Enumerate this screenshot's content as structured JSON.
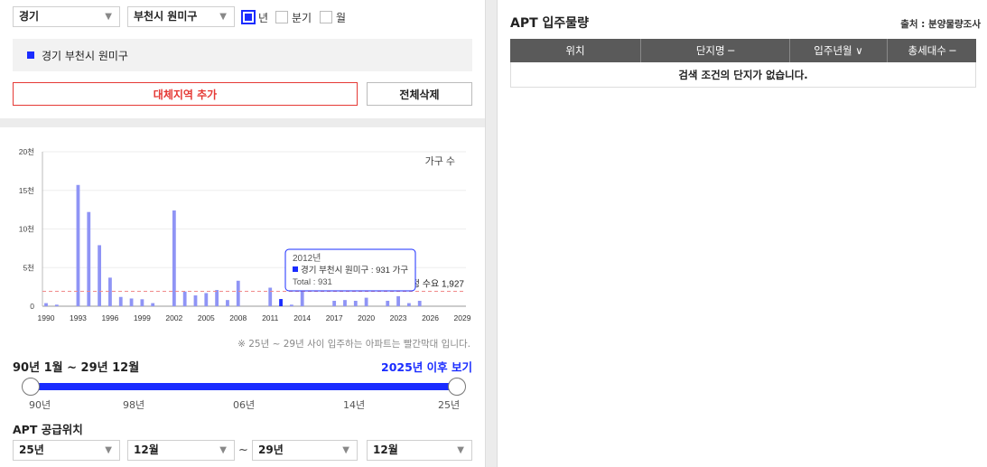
{
  "filters": {
    "province": "경기",
    "district": "부천시 원미구",
    "period_options": [
      {
        "label": "년",
        "checked": true
      },
      {
        "label": "분기",
        "checked": false
      },
      {
        "label": "월",
        "checked": false
      }
    ]
  },
  "selected_region": "경기 부천시 원미구",
  "buttons": {
    "add_region": "대체지역 추가",
    "delete_all": "전체삭제"
  },
  "chart_data": {
    "type": "bar",
    "unit_label": "가구 수",
    "y_ticks": [
      "0",
      "5천",
      "10천",
      "15천",
      "20천"
    ],
    "ylim": [
      0,
      20000
    ],
    "x_tick_labels": [
      "1990",
      "1993",
      "1996",
      "1999",
      "2002",
      "2005",
      "2008",
      "2011",
      "2014",
      "2017",
      "2020",
      "2023",
      "2026",
      "2029"
    ],
    "years": [
      1990,
      1991,
      1992,
      1993,
      1994,
      1995,
      1996,
      1997,
      1998,
      1999,
      2000,
      2001,
      2002,
      2003,
      2004,
      2005,
      2006,
      2007,
      2008,
      2009,
      2010,
      2011,
      2012,
      2013,
      2014,
      2015,
      2016,
      2017,
      2018,
      2019,
      2020,
      2021,
      2022,
      2023,
      2024,
      2025,
      2026,
      2027,
      2028,
      2029
    ],
    "values": [
      400,
      200,
      0,
      15700,
      12200,
      7900,
      3700,
      1200,
      1000,
      900,
      400,
      0,
      12400,
      1900,
      1400,
      1700,
      2100,
      800,
      3300,
      0,
      0,
      2400,
      931,
      200,
      2100,
      0,
      0,
      700,
      800,
      700,
      1100,
      0,
      700,
      1300,
      400,
      700,
      0,
      0,
      0,
      0
    ],
    "highlight_year": 2012,
    "demand_line": {
      "label": "적정 수요 1,927",
      "value": 1927
    },
    "tooltip": {
      "year": "2012년",
      "series": "경기 부천시 원미구 : 931 가구",
      "total": "Total : 931"
    },
    "bar_color": "#8f94f5",
    "highlight_color": "#1a2cff",
    "demand_color": "#f08a8a"
  },
  "note": "※ 25년 ~ 29년 사이 입주하는 아파트는 빨간막대 입니다.",
  "period_range": "90년 1월 ~ 29년 12월",
  "after_link": "2025년 이후 보기",
  "slider": {
    "ticks": [
      "90년",
      "98년",
      "06년",
      "14년",
      "25년"
    ]
  },
  "supply": {
    "title": "APT 공급위치",
    "from_year": "25년",
    "from_month": "12월",
    "separator": "~",
    "to_year": "29년",
    "to_month": "12월"
  },
  "right": {
    "title": "APT 입주물량",
    "source": "출처 : 분양물량조사",
    "columns": [
      "위치",
      "단지명 ─",
      "입주년월 ∨",
      "총세대수 ─"
    ],
    "empty_message": "검색 조건의 단지가 없습니다."
  }
}
